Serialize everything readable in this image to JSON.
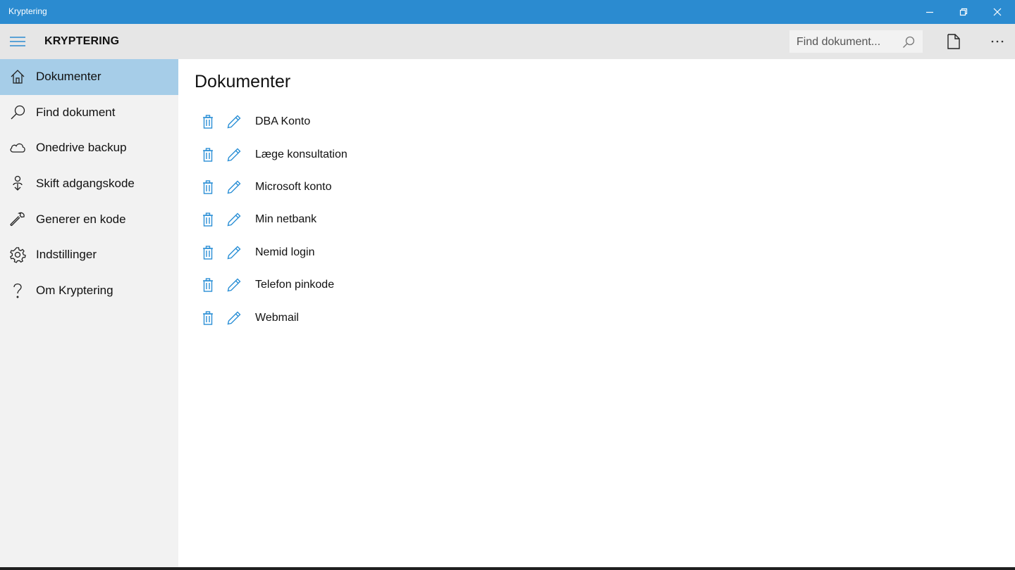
{
  "window": {
    "title": "Kryptering"
  },
  "appbar": {
    "title": "KRYPTERING",
    "search_placeholder": "Find dokument..."
  },
  "sidebar": {
    "items": [
      {
        "label": "Dokumenter",
        "icon": "home-icon",
        "active": true
      },
      {
        "label": "Find dokument",
        "icon": "search-icon"
      },
      {
        "label": "Onedrive backup",
        "icon": "cloud-icon"
      },
      {
        "label": "Skift adgangskode",
        "icon": "password-change-icon"
      },
      {
        "label": "Generer en kode",
        "icon": "wrench-icon"
      },
      {
        "label": "Indstillinger",
        "icon": "gear-icon"
      },
      {
        "label": "Om Kryptering",
        "icon": "question-icon"
      }
    ]
  },
  "main": {
    "heading": "Dokumenter",
    "documents": [
      {
        "name": "DBA Konto"
      },
      {
        "name": "Læge konsultation"
      },
      {
        "name": "Microsoft konto"
      },
      {
        "name": "Min netbank"
      },
      {
        "name": "Nemid login"
      },
      {
        "name": "Telefon pinkode"
      },
      {
        "name": "Webmail"
      }
    ]
  },
  "colors": {
    "titlebar": "#2b8bd0",
    "appbar": "#e6e6e6",
    "sidebar": "#f2f2f2",
    "active_item": "#a6cde8",
    "action_icons": "#2a8fd6"
  }
}
